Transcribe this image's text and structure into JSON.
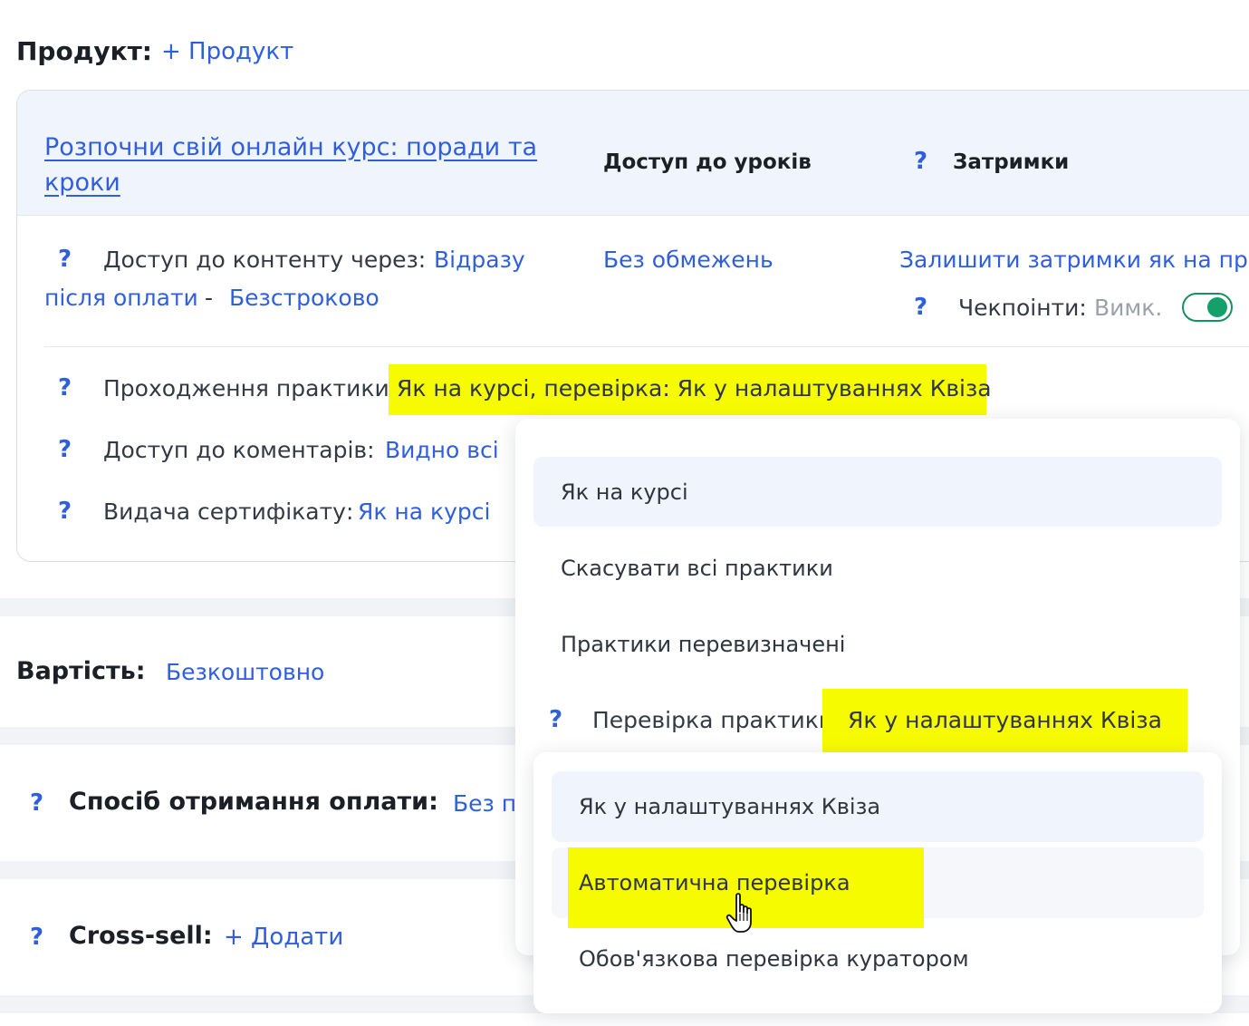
{
  "product": {
    "label": "Продукт:",
    "add_link": "+ Продукт"
  },
  "card": {
    "course_title_line1": "Розпочни свій онлайн курс: поради та",
    "course_title_line2": "кроки",
    "lessons_access_header": "Доступ до уроків",
    "delays_header": "Затримки",
    "content_access_label": "Доступ до контенту через:",
    "content_access_value1": "Відразу",
    "content_access_value2": "після оплати",
    "content_access_sep": "-",
    "content_access_value3": "Безстроково",
    "lessons_access_value": "Без обмежень",
    "delays_value": "Залишити затримки як на про",
    "checkpoints_label": "Чекпоінти:",
    "checkpoints_state": "Вимк.",
    "practice_label": "Проходження практики:",
    "practice_value": "Як на курсі, перевірка: Як у налаштуваннях Квіза",
    "comments_label": "Доступ до коментарів:",
    "comments_value": "Видно всі",
    "certificate_label": "Видача сертифікату:",
    "certificate_value": "Як на курсі"
  },
  "price": {
    "label": "Вартість:",
    "value": "Безкоштовно"
  },
  "payment": {
    "label": "Спосіб отримання оплати:",
    "value": "Без п"
  },
  "crosssell": {
    "label": "Cross-sell:",
    "add_link": "+ Додати"
  },
  "practice_dropdown": {
    "options": [
      "Як на курсі",
      "Скасувати всі практики",
      "Практики перевизначені"
    ],
    "check_label": "Перевірка практики:",
    "check_value": "Як у налаштуваннях Квіза"
  },
  "check_dropdown": {
    "options": [
      "Як у налаштуваннях Квіза",
      "Автоматична перевірка",
      "Обов'язкова перевірка куратором"
    ]
  },
  "question_mark": "?",
  "colors": {
    "accent": "#2f5fe0",
    "highlight": "#f7fb00",
    "toggle_on": "#14a06a",
    "header_bg": "#f0f4fd"
  }
}
